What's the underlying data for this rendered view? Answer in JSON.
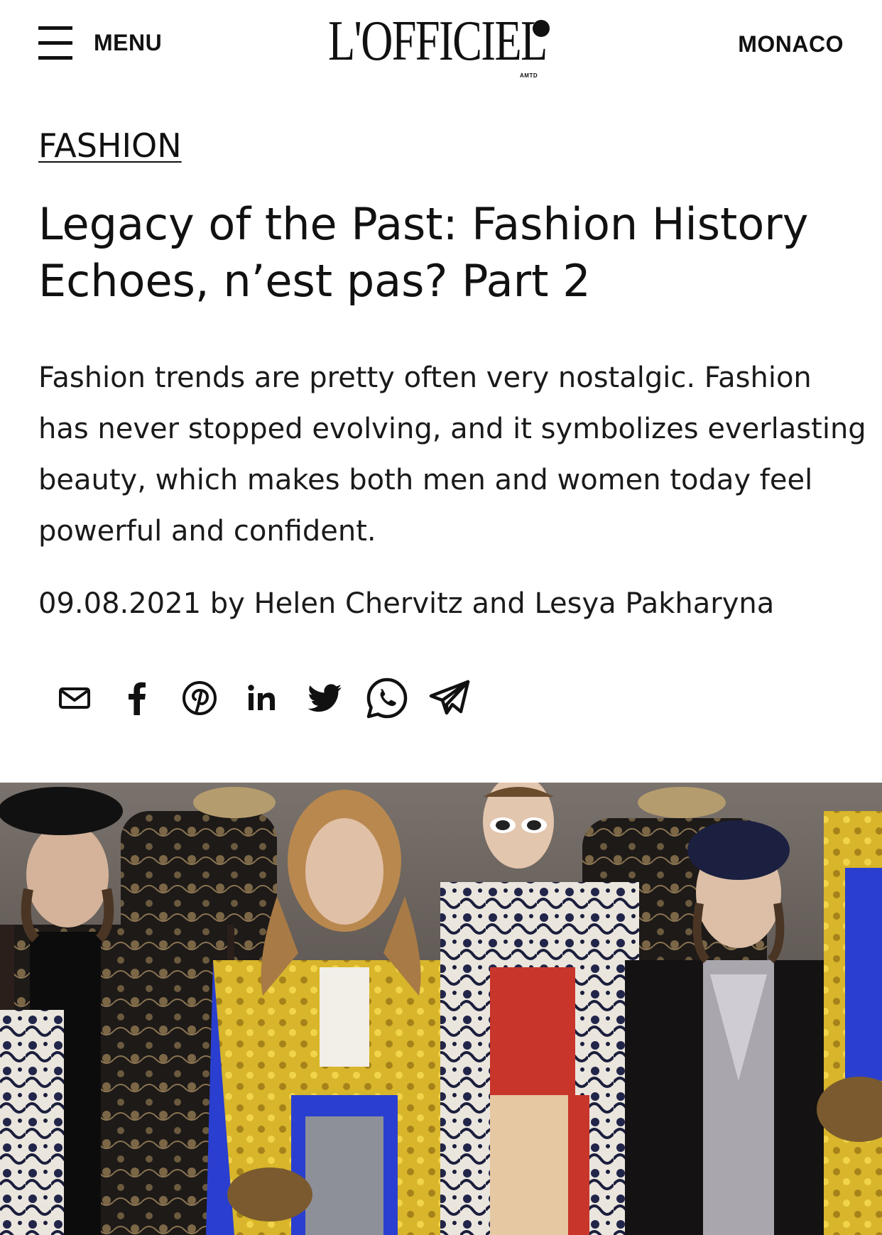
{
  "header": {
    "menu_label": "MENU",
    "logo_text": "L'OFFICIEL",
    "logo_sub": "AMTD",
    "region": "MONACO"
  },
  "article": {
    "category": "FASHION",
    "title": "Legacy of the Past: Fashion History Echoes, n’est pas? Part 2",
    "lead": "Fashion trends are pretty often very nostalgic. Fashion has never stopped evolving, and it symbolizes everlasting beauty, which makes both men and women today feel powerful and confident.",
    "byline": "09.08.2021 by Helen Chervitz and Lesya Pakharyna"
  },
  "share": {
    "icons": [
      "mail-icon",
      "facebook-icon",
      "pinterest-icon",
      "linkedin-icon",
      "twitter-icon",
      "whatsapp-icon",
      "telegram-icon"
    ]
  },
  "hero": {
    "colors": {
      "background": "#6b6460",
      "gold": "#d8b52a",
      "royal_blue": "#2a3fcf",
      "red": "#c8352b",
      "black": "#141212",
      "cream": "#eae6de"
    }
  }
}
